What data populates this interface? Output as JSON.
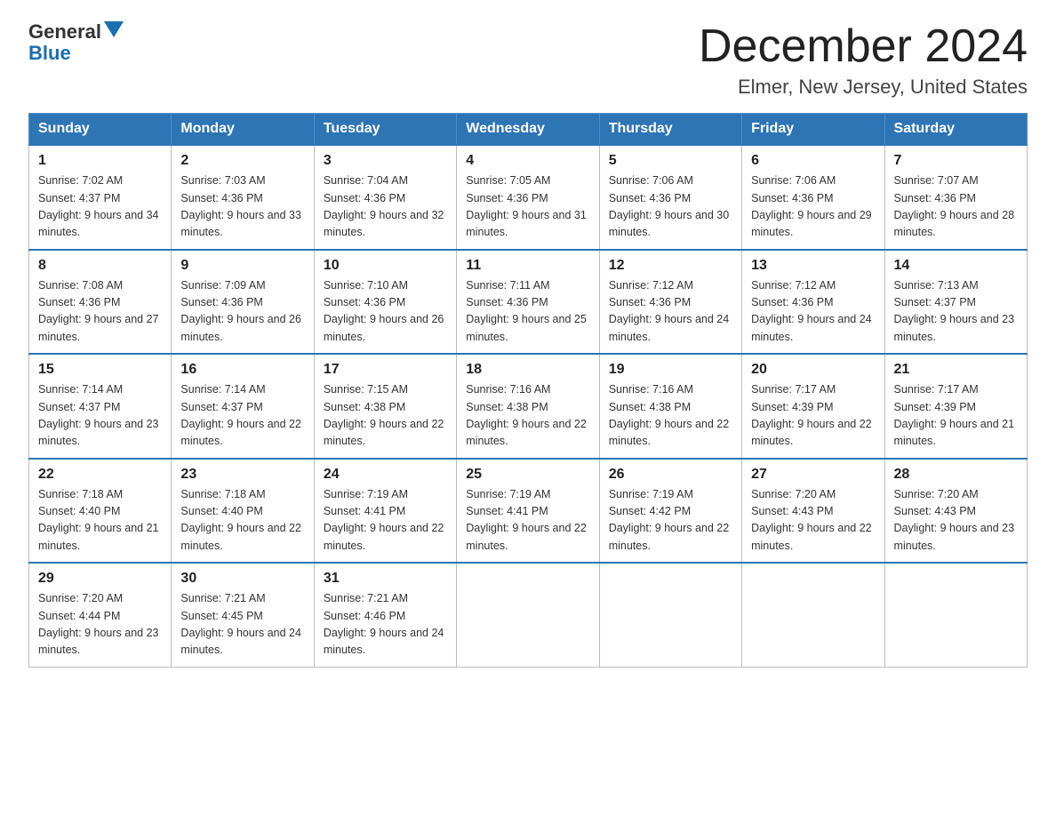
{
  "header": {
    "logo_line1": "General",
    "logo_line2": "Blue",
    "month_title": "December 2024",
    "location": "Elmer, New Jersey, United States"
  },
  "days_of_week": [
    "Sunday",
    "Monday",
    "Tuesday",
    "Wednesday",
    "Thursday",
    "Friday",
    "Saturday"
  ],
  "weeks": [
    [
      {
        "day": "1",
        "sunrise": "7:02 AM",
        "sunset": "4:37 PM",
        "daylight": "9 hours and 34 minutes."
      },
      {
        "day": "2",
        "sunrise": "7:03 AM",
        "sunset": "4:36 PM",
        "daylight": "9 hours and 33 minutes."
      },
      {
        "day": "3",
        "sunrise": "7:04 AM",
        "sunset": "4:36 PM",
        "daylight": "9 hours and 32 minutes."
      },
      {
        "day": "4",
        "sunrise": "7:05 AM",
        "sunset": "4:36 PM",
        "daylight": "9 hours and 31 minutes."
      },
      {
        "day": "5",
        "sunrise": "7:06 AM",
        "sunset": "4:36 PM",
        "daylight": "9 hours and 30 minutes."
      },
      {
        "day": "6",
        "sunrise": "7:06 AM",
        "sunset": "4:36 PM",
        "daylight": "9 hours and 29 minutes."
      },
      {
        "day": "7",
        "sunrise": "7:07 AM",
        "sunset": "4:36 PM",
        "daylight": "9 hours and 28 minutes."
      }
    ],
    [
      {
        "day": "8",
        "sunrise": "7:08 AM",
        "sunset": "4:36 PM",
        "daylight": "9 hours and 27 minutes."
      },
      {
        "day": "9",
        "sunrise": "7:09 AM",
        "sunset": "4:36 PM",
        "daylight": "9 hours and 26 minutes."
      },
      {
        "day": "10",
        "sunrise": "7:10 AM",
        "sunset": "4:36 PM",
        "daylight": "9 hours and 26 minutes."
      },
      {
        "day": "11",
        "sunrise": "7:11 AM",
        "sunset": "4:36 PM",
        "daylight": "9 hours and 25 minutes."
      },
      {
        "day": "12",
        "sunrise": "7:12 AM",
        "sunset": "4:36 PM",
        "daylight": "9 hours and 24 minutes."
      },
      {
        "day": "13",
        "sunrise": "7:12 AM",
        "sunset": "4:36 PM",
        "daylight": "9 hours and 24 minutes."
      },
      {
        "day": "14",
        "sunrise": "7:13 AM",
        "sunset": "4:37 PM",
        "daylight": "9 hours and 23 minutes."
      }
    ],
    [
      {
        "day": "15",
        "sunrise": "7:14 AM",
        "sunset": "4:37 PM",
        "daylight": "9 hours and 23 minutes."
      },
      {
        "day": "16",
        "sunrise": "7:14 AM",
        "sunset": "4:37 PM",
        "daylight": "9 hours and 22 minutes."
      },
      {
        "day": "17",
        "sunrise": "7:15 AM",
        "sunset": "4:38 PM",
        "daylight": "9 hours and 22 minutes."
      },
      {
        "day": "18",
        "sunrise": "7:16 AM",
        "sunset": "4:38 PM",
        "daylight": "9 hours and 22 minutes."
      },
      {
        "day": "19",
        "sunrise": "7:16 AM",
        "sunset": "4:38 PM",
        "daylight": "9 hours and 22 minutes."
      },
      {
        "day": "20",
        "sunrise": "7:17 AM",
        "sunset": "4:39 PM",
        "daylight": "9 hours and 22 minutes."
      },
      {
        "day": "21",
        "sunrise": "7:17 AM",
        "sunset": "4:39 PM",
        "daylight": "9 hours and 21 minutes."
      }
    ],
    [
      {
        "day": "22",
        "sunrise": "7:18 AM",
        "sunset": "4:40 PM",
        "daylight": "9 hours and 21 minutes."
      },
      {
        "day": "23",
        "sunrise": "7:18 AM",
        "sunset": "4:40 PM",
        "daylight": "9 hours and 22 minutes."
      },
      {
        "day": "24",
        "sunrise": "7:19 AM",
        "sunset": "4:41 PM",
        "daylight": "9 hours and 22 minutes."
      },
      {
        "day": "25",
        "sunrise": "7:19 AM",
        "sunset": "4:41 PM",
        "daylight": "9 hours and 22 minutes."
      },
      {
        "day": "26",
        "sunrise": "7:19 AM",
        "sunset": "4:42 PM",
        "daylight": "9 hours and 22 minutes."
      },
      {
        "day": "27",
        "sunrise": "7:20 AM",
        "sunset": "4:43 PM",
        "daylight": "9 hours and 22 minutes."
      },
      {
        "day": "28",
        "sunrise": "7:20 AM",
        "sunset": "4:43 PM",
        "daylight": "9 hours and 23 minutes."
      }
    ],
    [
      {
        "day": "29",
        "sunrise": "7:20 AM",
        "sunset": "4:44 PM",
        "daylight": "9 hours and 23 minutes."
      },
      {
        "day": "30",
        "sunrise": "7:21 AM",
        "sunset": "4:45 PM",
        "daylight": "9 hours and 24 minutes."
      },
      {
        "day": "31",
        "sunrise": "7:21 AM",
        "sunset": "4:46 PM",
        "daylight": "9 hours and 24 minutes."
      },
      null,
      null,
      null,
      null
    ]
  ]
}
